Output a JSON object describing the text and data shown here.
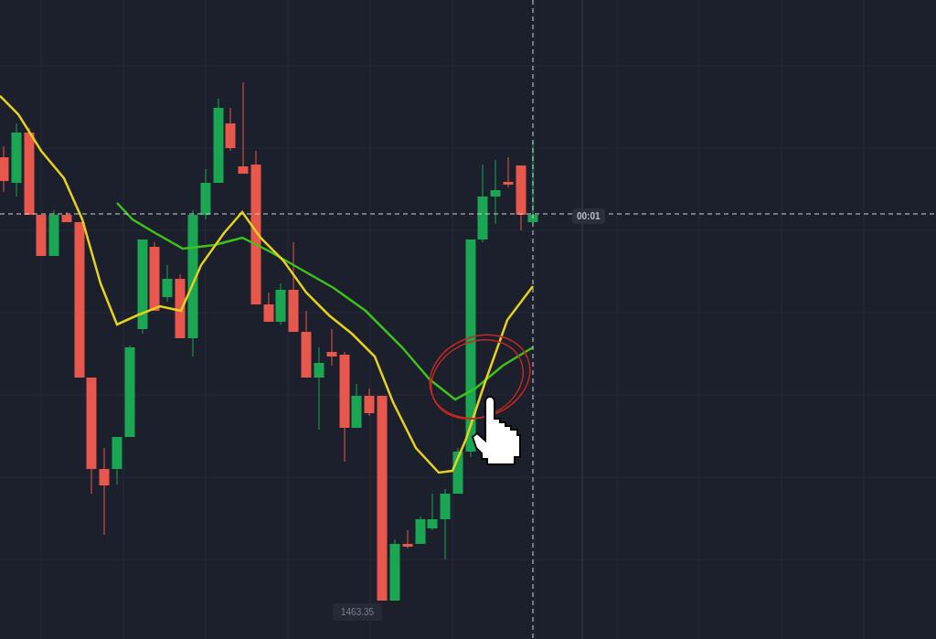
{
  "chart": {
    "crosshair_time_label": "00:01",
    "crosshair_price_label": "1463.35"
  }
}
